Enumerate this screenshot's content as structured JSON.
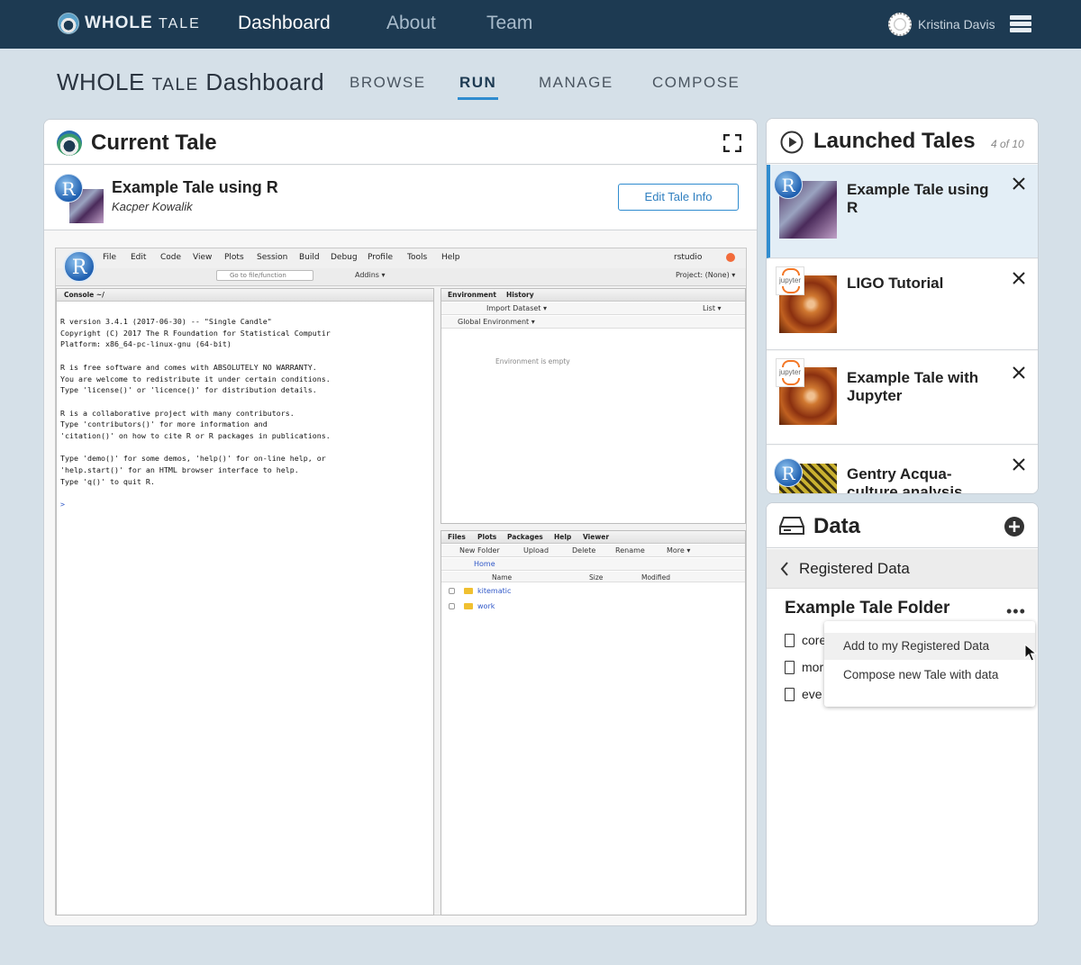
{
  "topnav": {
    "logo_main": "WHOLE",
    "logo_sub": "TALE",
    "links": [
      "Dashboard",
      "About",
      "Team"
    ],
    "user_name": "Kristina Davis"
  },
  "subheader": {
    "title_main": "WHOLE",
    "title_sub": "TALE",
    "title_rest": "Dashboard",
    "tabs": [
      "BROWSE",
      "RUN",
      "MANAGE",
      "COMPOSE"
    ],
    "active_tab": "RUN"
  },
  "current_tale": {
    "heading": "Current Tale",
    "tale_name": "Example Tale using R",
    "author": "Kacper Kowalik",
    "edit_button": "Edit Tale Info",
    "r_badge": "R"
  },
  "rstudio": {
    "menus": [
      "File",
      "Edit",
      "Code",
      "View",
      "Plots",
      "Session",
      "Build",
      "Debug",
      "Profile",
      "Tools",
      "Help"
    ],
    "user": "rstudio",
    "goto_placeholder": "Go to file/function",
    "addins": "Addins ▾",
    "project": "Project: (None) ▾",
    "console_tab": "Console ~/",
    "console_text": "R version 3.4.1 (2017-06-30) -- \"Single Candle\"\nCopyright (C) 2017 The R Foundation for Statistical Computir\nPlatform: x86_64-pc-linux-gnu (64-bit)\n\nR is free software and comes with ABSOLUTELY NO WARRANTY.\nYou are welcome to redistribute it under certain conditions.\nType 'license()' or 'licence()' for distribution details.\n\nR is a collaborative project with many contributors.\nType 'contributors()' for more information and\n'citation()' on how to cite R or R packages in publications.\n\nType 'demo()' for some demos, 'help()' for on-line help, or\n'help.start()' for an HTML browser interface to help.\nType 'q()' to quit R.",
    "prompt": ">",
    "env_tabs": [
      "Environment",
      "History"
    ],
    "import_dataset": "Import Dataset ▾",
    "list_label": "List ▾",
    "global_env": "Global Environment ▾",
    "env_empty": "Environment is empty",
    "files_tabs": [
      "Files",
      "Plots",
      "Packages",
      "Help",
      "Viewer"
    ],
    "file_actions": [
      "New Folder",
      "Upload",
      "Delete",
      "Rename",
      "More ▾"
    ],
    "home": "Home",
    "columns": [
      "Name",
      "Size",
      "Modified"
    ],
    "files": [
      "kitematic",
      "work"
    ]
  },
  "launched_tales": {
    "heading": "Launched Tales",
    "count": "4 of 10",
    "items": [
      {
        "title": "Example Tale using R",
        "type": "r"
      },
      {
        "title": "LIGO Tutorial",
        "type": "jupyter"
      },
      {
        "title": "Example Tale with Jupyter",
        "type": "jupyter"
      },
      {
        "title": "Gentry Acqua-culture analysis",
        "type": "r"
      }
    ],
    "jupyter_label": "jupyter"
  },
  "data": {
    "heading": "Data",
    "registered": "Registered Data",
    "folder": "Example Tale Folder",
    "files": [
      "core",
      "mor",
      "eve"
    ],
    "menu": [
      "Add to my Registered Data",
      "Compose new Tale with data"
    ]
  },
  "colors": {
    "nav_bg": "#1d3a52",
    "accent": "#2f8ccf",
    "page_bg": "#d5e0e8"
  }
}
